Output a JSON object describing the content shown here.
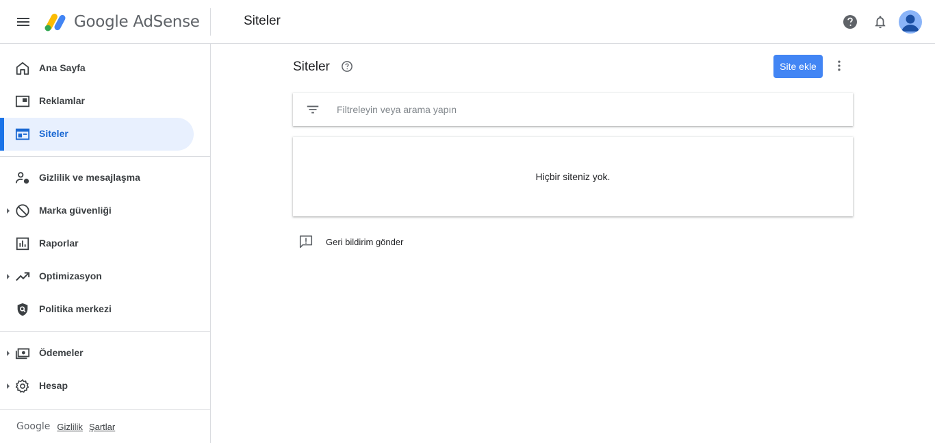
{
  "header": {
    "product_name": "Google AdSense",
    "page_title": "Siteler"
  },
  "sidebar": {
    "items": [
      {
        "label": "Ana Sayfa",
        "icon": "home-icon"
      },
      {
        "label": "Reklamlar",
        "icon": "ads-icon"
      },
      {
        "label": "Siteler",
        "icon": "sites-icon",
        "active": true
      },
      {
        "label": "Gizlilik ve mesajlaşma",
        "icon": "privacy-icon"
      },
      {
        "label": "Marka güvenliği",
        "icon": "block-icon",
        "expandable": true
      },
      {
        "label": "Raporlar",
        "icon": "reports-icon"
      },
      {
        "label": "Optimizasyon",
        "icon": "trending-up-icon",
        "expandable": true
      },
      {
        "label": "Politika merkezi",
        "icon": "policy-shield-icon"
      },
      {
        "label": "Ödemeler",
        "icon": "payments-icon",
        "expandable": true
      },
      {
        "label": "Hesap",
        "icon": "gear-icon",
        "expandable": true
      }
    ],
    "footer": {
      "brand": "Google",
      "privacy": "Gizlilik",
      "terms": "Şartlar"
    }
  },
  "main": {
    "title": "Siteler",
    "add_site_label": "Site ekle",
    "filter_placeholder": "Filtreleyin veya arama yapın",
    "empty_message": "Hiçbir siteniz yok.",
    "feedback_label": "Geri bildirim gönder"
  },
  "colors": {
    "accent": "#1a73e8",
    "button": "#4285f4",
    "active_bg": "#e8f0fe"
  }
}
